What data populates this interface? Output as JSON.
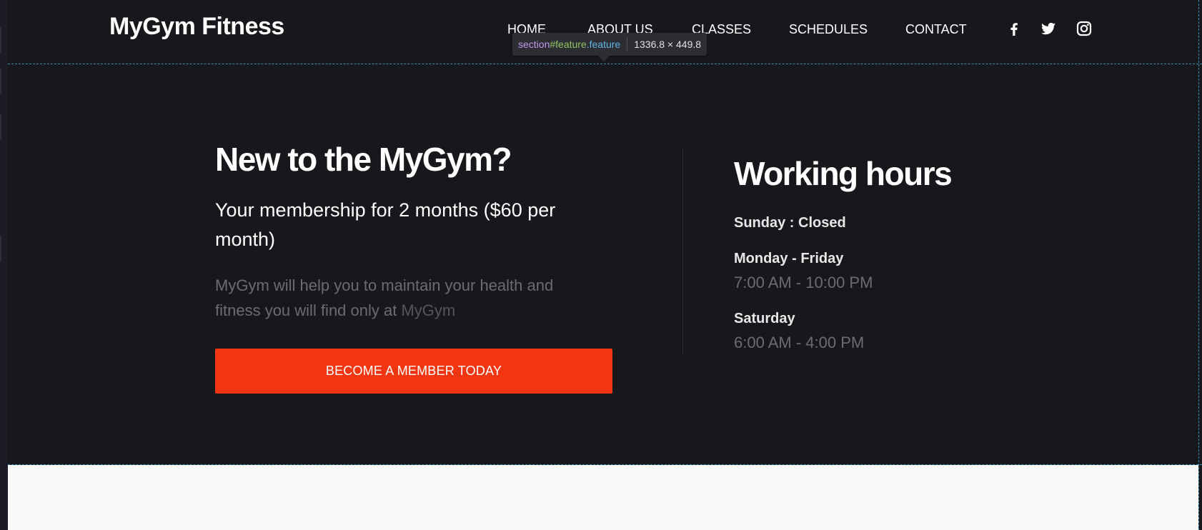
{
  "header": {
    "brand": "MyGym Fitness",
    "nav": [
      "HOME",
      "ABOUT US",
      "CLASSES",
      "SCHEDULES",
      "CONTACT"
    ],
    "social_icons": [
      "facebook-icon",
      "twitter-icon",
      "instagram-icon"
    ]
  },
  "devtools_tooltip": {
    "tag": "section",
    "id": "#feature",
    "cls": ".feature",
    "dimensions": "1336.8 × 449.8"
  },
  "feature": {
    "heading": "New to the MyGym?",
    "subheading": "Your membership for 2 months ($60 per month)",
    "description_text": "MyGym will help you to maintain your health and fitness you will find only at",
    "description_highlight": "MyGym",
    "cta_label": "BECOME A MEMBER TODAY"
  },
  "working_hours": {
    "heading": "Working hours",
    "entries": [
      {
        "day": "Sunday : Closed",
        "hours": ""
      },
      {
        "day": "Monday - Friday",
        "hours": "7:00 AM - 10:00 PM"
      },
      {
        "day": "Saturday",
        "hours": "6:00 AM - 4:00 PM"
      }
    ]
  },
  "colors": {
    "background": "#17181c",
    "accent": "#f23612",
    "muted_text": "#6b6c70",
    "lower_section": "#f9f9fa"
  }
}
